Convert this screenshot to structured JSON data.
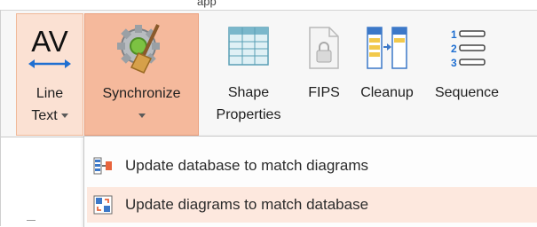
{
  "window": {
    "partial_top_text": "app"
  },
  "ribbon": {
    "buttons": [
      {
        "id": "line-text",
        "label_line1": "Line",
        "label_line2": "Text",
        "has_dropdown": true,
        "icon": "av-arrow-icon",
        "state": "highlighted"
      },
      {
        "id": "synchronize",
        "label_line1": "Synchronize",
        "has_dropdown": true,
        "icon": "gear-broom-icon",
        "state": "pressed"
      },
      {
        "id": "shape-properties",
        "label_line1": "Shape",
        "label_line2": "Properties",
        "has_dropdown": false,
        "icon": "table-grid-icon",
        "state": "normal"
      },
      {
        "id": "fips",
        "label_line1": "FIPS",
        "has_dropdown": false,
        "icon": "document-lock-icon",
        "state": "disabled"
      },
      {
        "id": "cleanup",
        "label_line1": "Cleanup",
        "has_dropdown": false,
        "icon": "columns-transfer-icon",
        "state": "normal"
      },
      {
        "id": "sequence",
        "label_line1": "Sequence",
        "has_dropdown": false,
        "icon": "numbered-list-icon",
        "state": "normal"
      }
    ]
  },
  "dropdown": {
    "items": [
      {
        "label": "Update database to match diagrams",
        "icon": "diagram-to-database-icon"
      },
      {
        "label": "Update diagrams to match database",
        "icon": "database-to-diagram-icon",
        "state": "hovered"
      }
    ]
  },
  "colors": {
    "pressed": "#f5b99c",
    "highlighted": "#fbe1d3",
    "menu_hover": "#fde8de",
    "accent_blue": "#1f6fd1"
  }
}
